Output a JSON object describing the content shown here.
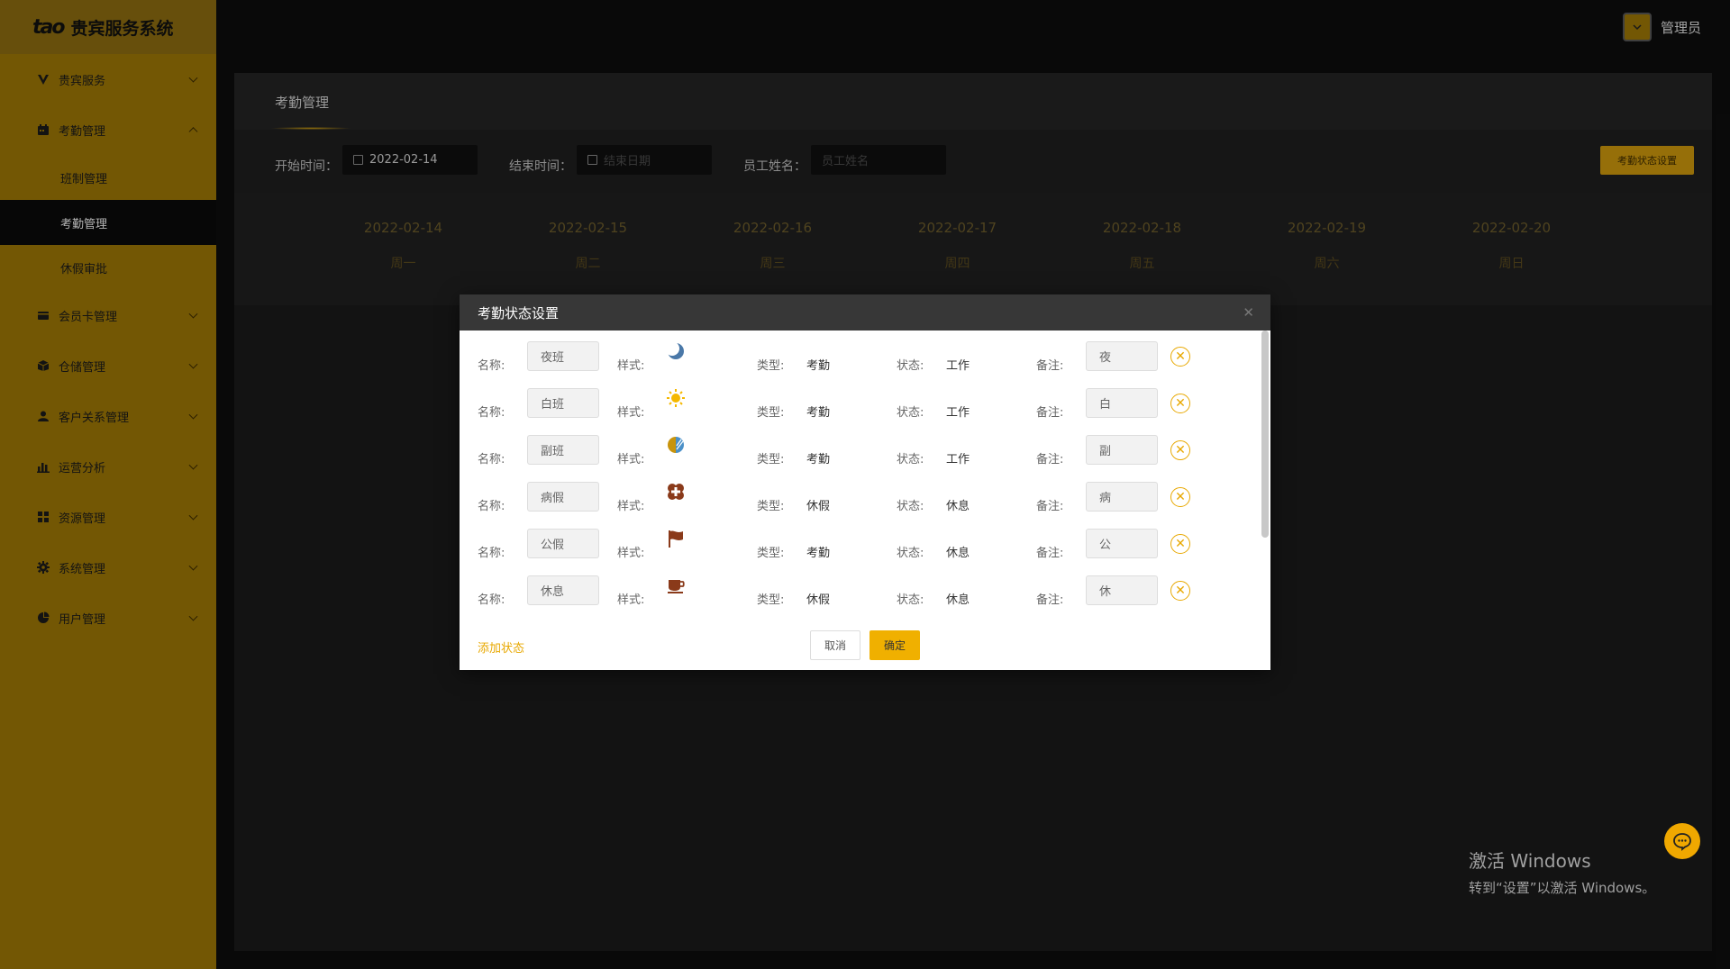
{
  "app": {
    "logo_mark": "tao",
    "title": "贵宾服务系统"
  },
  "user": {
    "name": "管理员"
  },
  "sidebar": {
    "items": [
      {
        "label": "贵宾服务",
        "icon": "v-icon"
      },
      {
        "label": "考勤管理",
        "icon": "calendar-icon",
        "expanded": true
      },
      {
        "label": "会员卡管理",
        "icon": "card-icon"
      },
      {
        "label": "仓储管理",
        "icon": "box-icon"
      },
      {
        "label": "客户关系管理",
        "icon": "user-icon"
      },
      {
        "label": "运营分析",
        "icon": "bar-chart-icon"
      },
      {
        "label": "资源管理",
        "icon": "grid-icon"
      },
      {
        "label": "系统管理",
        "icon": "gear-icon"
      },
      {
        "label": "用户管理",
        "icon": "pie-icon"
      }
    ],
    "sub_items": [
      "班制管理",
      "考勤管理",
      "休假审批"
    ],
    "active_sub": "考勤管理"
  },
  "main": {
    "tab": "考勤管理",
    "filters": {
      "start_label": "开始时间：",
      "start_value": "2022-02-14",
      "end_label": "结束时间：",
      "end_placeholder": "结束日期",
      "name_label": "员工姓名：",
      "name_placeholder": "员工姓名",
      "status_button": "考勤状态设置"
    },
    "days": [
      {
        "date": "2022-02-14",
        "weekday": "周一"
      },
      {
        "date": "2022-02-15",
        "weekday": "周二"
      },
      {
        "date": "2022-02-16",
        "weekday": "周三"
      },
      {
        "date": "2022-02-17",
        "weekday": "周四"
      },
      {
        "date": "2022-02-18",
        "weekday": "周五"
      },
      {
        "date": "2022-02-19",
        "weekday": "周六"
      },
      {
        "date": "2022-02-20",
        "weekday": "周日"
      }
    ]
  },
  "modal": {
    "title": "考勤状态设置",
    "labels": {
      "name": "名称:",
      "style": "样式:",
      "type": "类型:",
      "state": "状态:",
      "note": "备注:"
    },
    "rows": [
      {
        "name": "夜班",
        "icon": "moon-icon",
        "type": "考勤",
        "state": "工作",
        "note": "夜"
      },
      {
        "name": "白班",
        "icon": "sun-icon",
        "type": "考勤",
        "state": "工作",
        "note": "白"
      },
      {
        "name": "副班",
        "icon": "half-circle-icon",
        "type": "考勤",
        "state": "工作",
        "note": "副"
      },
      {
        "name": "病假",
        "icon": "medical-cross-icon",
        "type": "休假",
        "state": "休息",
        "note": "病"
      },
      {
        "name": "公假",
        "icon": "flag-icon",
        "type": "考勤",
        "state": "休息",
        "note": "公"
      },
      {
        "name": "休息",
        "icon": "coffee-icon",
        "type": "休假",
        "state": "休息",
        "note": "休"
      }
    ],
    "add_label": "添加状态",
    "cancel_label": "取消",
    "ok_label": "确定"
  },
  "watermark": {
    "line1": "激活 Windows",
    "line2": "转到“设置”以激活 Windows。"
  },
  "colors": {
    "sidebar": "#9a7406",
    "accent": "#f0b000",
    "dark": "#0d0d0d"
  }
}
